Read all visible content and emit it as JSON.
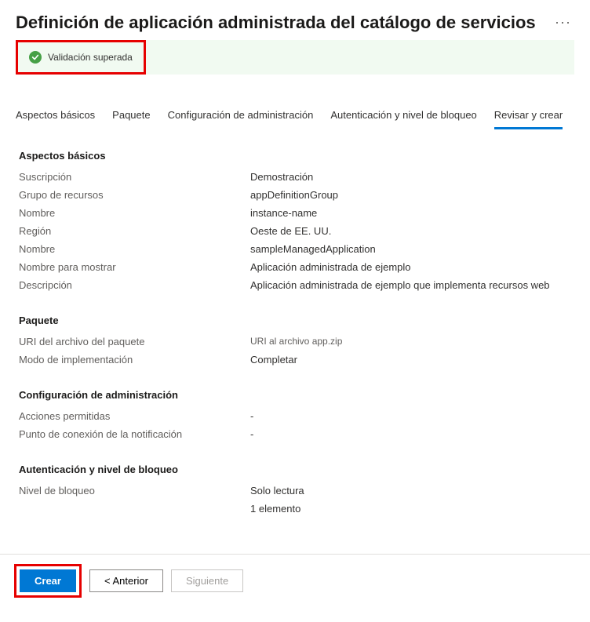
{
  "header": {
    "title": "Definición de aplicación administrada del catálogo de servicios"
  },
  "validation": {
    "text": "Validación superada"
  },
  "tabs": [
    {
      "label": "Aspectos básicos"
    },
    {
      "label": "Paquete"
    },
    {
      "label": "Configuración de administración"
    },
    {
      "label": "Autenticación y nivel de bloqueo"
    },
    {
      "label": "Revisar y crear"
    }
  ],
  "sections": {
    "basics": {
      "title": "Aspectos básicos",
      "rows": [
        {
          "key": "Suscripción",
          "val": "Demostración"
        },
        {
          "key": "Grupo de recursos",
          "val": "appDefinitionGroup"
        },
        {
          "key": "Nombre",
          "val": "instance-name"
        },
        {
          "key": "Región",
          "val": "Oeste de EE. UU."
        },
        {
          "key": "Nombre",
          "val": "sampleManagedApplication"
        },
        {
          "key": "Nombre para mostrar",
          "val": "Aplicación administrada de ejemplo"
        },
        {
          "key": "Descripción",
          "val": "Aplicación administrada de ejemplo que implementa recursos web"
        }
      ]
    },
    "package": {
      "title": "Paquete",
      "rows": [
        {
          "key": "URI del archivo del paquete",
          "val": "URI al archivo app.zip",
          "muted": true
        },
        {
          "key": "Modo de implementación",
          "val": "Completar"
        }
      ]
    },
    "admin": {
      "title": "Configuración de administración",
      "rows": [
        {
          "key": "Acciones permitidas",
          "val": "-"
        },
        {
          "key": "Punto de conexión de la notificación",
          "val": "-"
        }
      ]
    },
    "auth": {
      "title": "Autenticación y nivel de bloqueo",
      "rows": [
        {
          "key": "Nivel de bloqueo",
          "val": "Solo lectura"
        },
        {
          "key": "",
          "val": "1 elemento"
        }
      ]
    }
  },
  "footer": {
    "create": "Crear",
    "previous": "<  Anterior",
    "next": "Siguiente"
  }
}
